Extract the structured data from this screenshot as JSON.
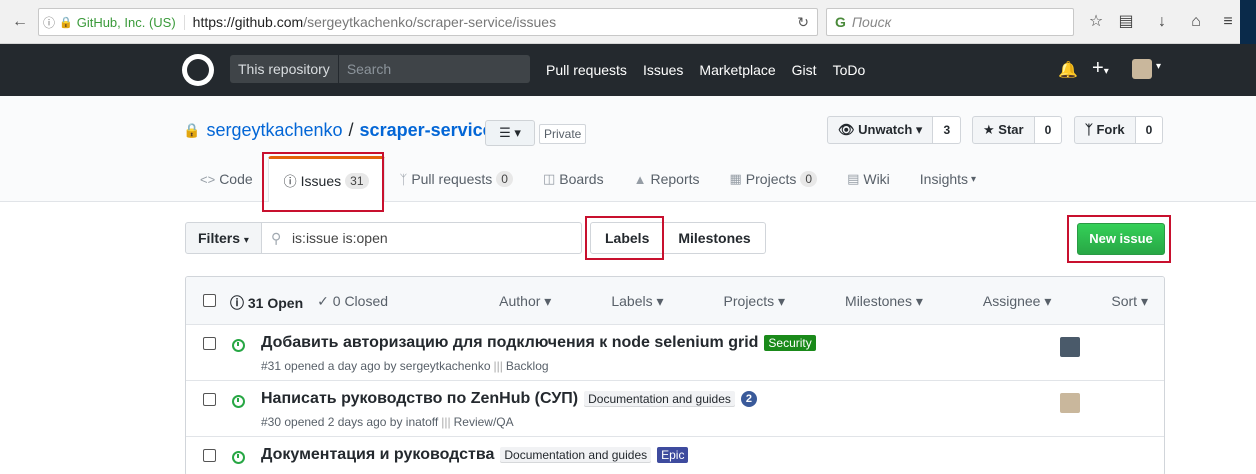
{
  "browser": {
    "identity": "GitHub, Inc. (US)",
    "url_host": "https://github.com",
    "url_path": "/sergeytkachenko/scraper-service/issues",
    "search_placeholder": "Поиск"
  },
  "header": {
    "scope_label": "This repository",
    "search_placeholder": "Search",
    "nav": [
      "Pull requests",
      "Issues",
      "Marketplace",
      "Gist",
      "ToDo"
    ]
  },
  "repo": {
    "owner": "sergeytkachenko",
    "name": "scraper-service",
    "private_label": "Private",
    "unwatch_label": "Unwatch",
    "watch_count": "3",
    "star_label": "Star",
    "star_count": "0",
    "fork_label": "Fork",
    "fork_count": "0"
  },
  "tabs": [
    {
      "label": "Code",
      "icon": "code-icon"
    },
    {
      "label": "Issues",
      "count": "31",
      "icon": "issue-opened-icon",
      "selected": true
    },
    {
      "label": "Pull requests",
      "count": "0",
      "icon": "git-pull-request-icon"
    },
    {
      "label": "Boards",
      "icon": "boards-icon"
    },
    {
      "label": "Reports",
      "icon": "graph-icon"
    },
    {
      "label": "Projects",
      "count": "0",
      "icon": "project-icon"
    },
    {
      "label": "Wiki",
      "icon": "book-icon"
    },
    {
      "label": "Insights",
      "icon": "chevron-down-icon"
    }
  ],
  "filters": {
    "button_label": "Filters",
    "query": "is:issue is:open",
    "labels_label": "Labels",
    "milestones_label": "Milestones",
    "new_issue_label": "New issue"
  },
  "issues_header": {
    "open_label": "31 Open",
    "closed_label": "0 Closed",
    "menus": [
      "Author",
      "Labels",
      "Projects",
      "Milestones",
      "Assignee",
      "Sort"
    ]
  },
  "issues": [
    {
      "title": "Добавить авторизацию для подключения к node selenium grid",
      "labels": [
        {
          "text": "Security",
          "bg": "#1a8a1a",
          "fg": "#ffffff"
        }
      ],
      "meta": "#31 opened a day ago by sergeytkachenko",
      "pipeline": "Backlog",
      "assignee_color": "#4a5a6a"
    },
    {
      "title": "Написать руководство по ZenHub (СУП)",
      "labels": [
        {
          "text": "Documentation and guides",
          "bg": "#f1f2f4",
          "fg": "#24292e"
        }
      ],
      "badge": "2",
      "meta": "#30 opened 2 days ago by inatoff",
      "pipeline": "Review/QA",
      "assignee_color": "#c9b79c"
    },
    {
      "title": "Документация и руководства",
      "labels": [
        {
          "text": "Documentation and guides",
          "bg": "#f1f2f4",
          "fg": "#24292e"
        },
        {
          "text": "Epic",
          "bg": "#3e4b9e",
          "fg": "#ffffff"
        }
      ],
      "meta": "",
      "pipeline": ""
    }
  ]
}
